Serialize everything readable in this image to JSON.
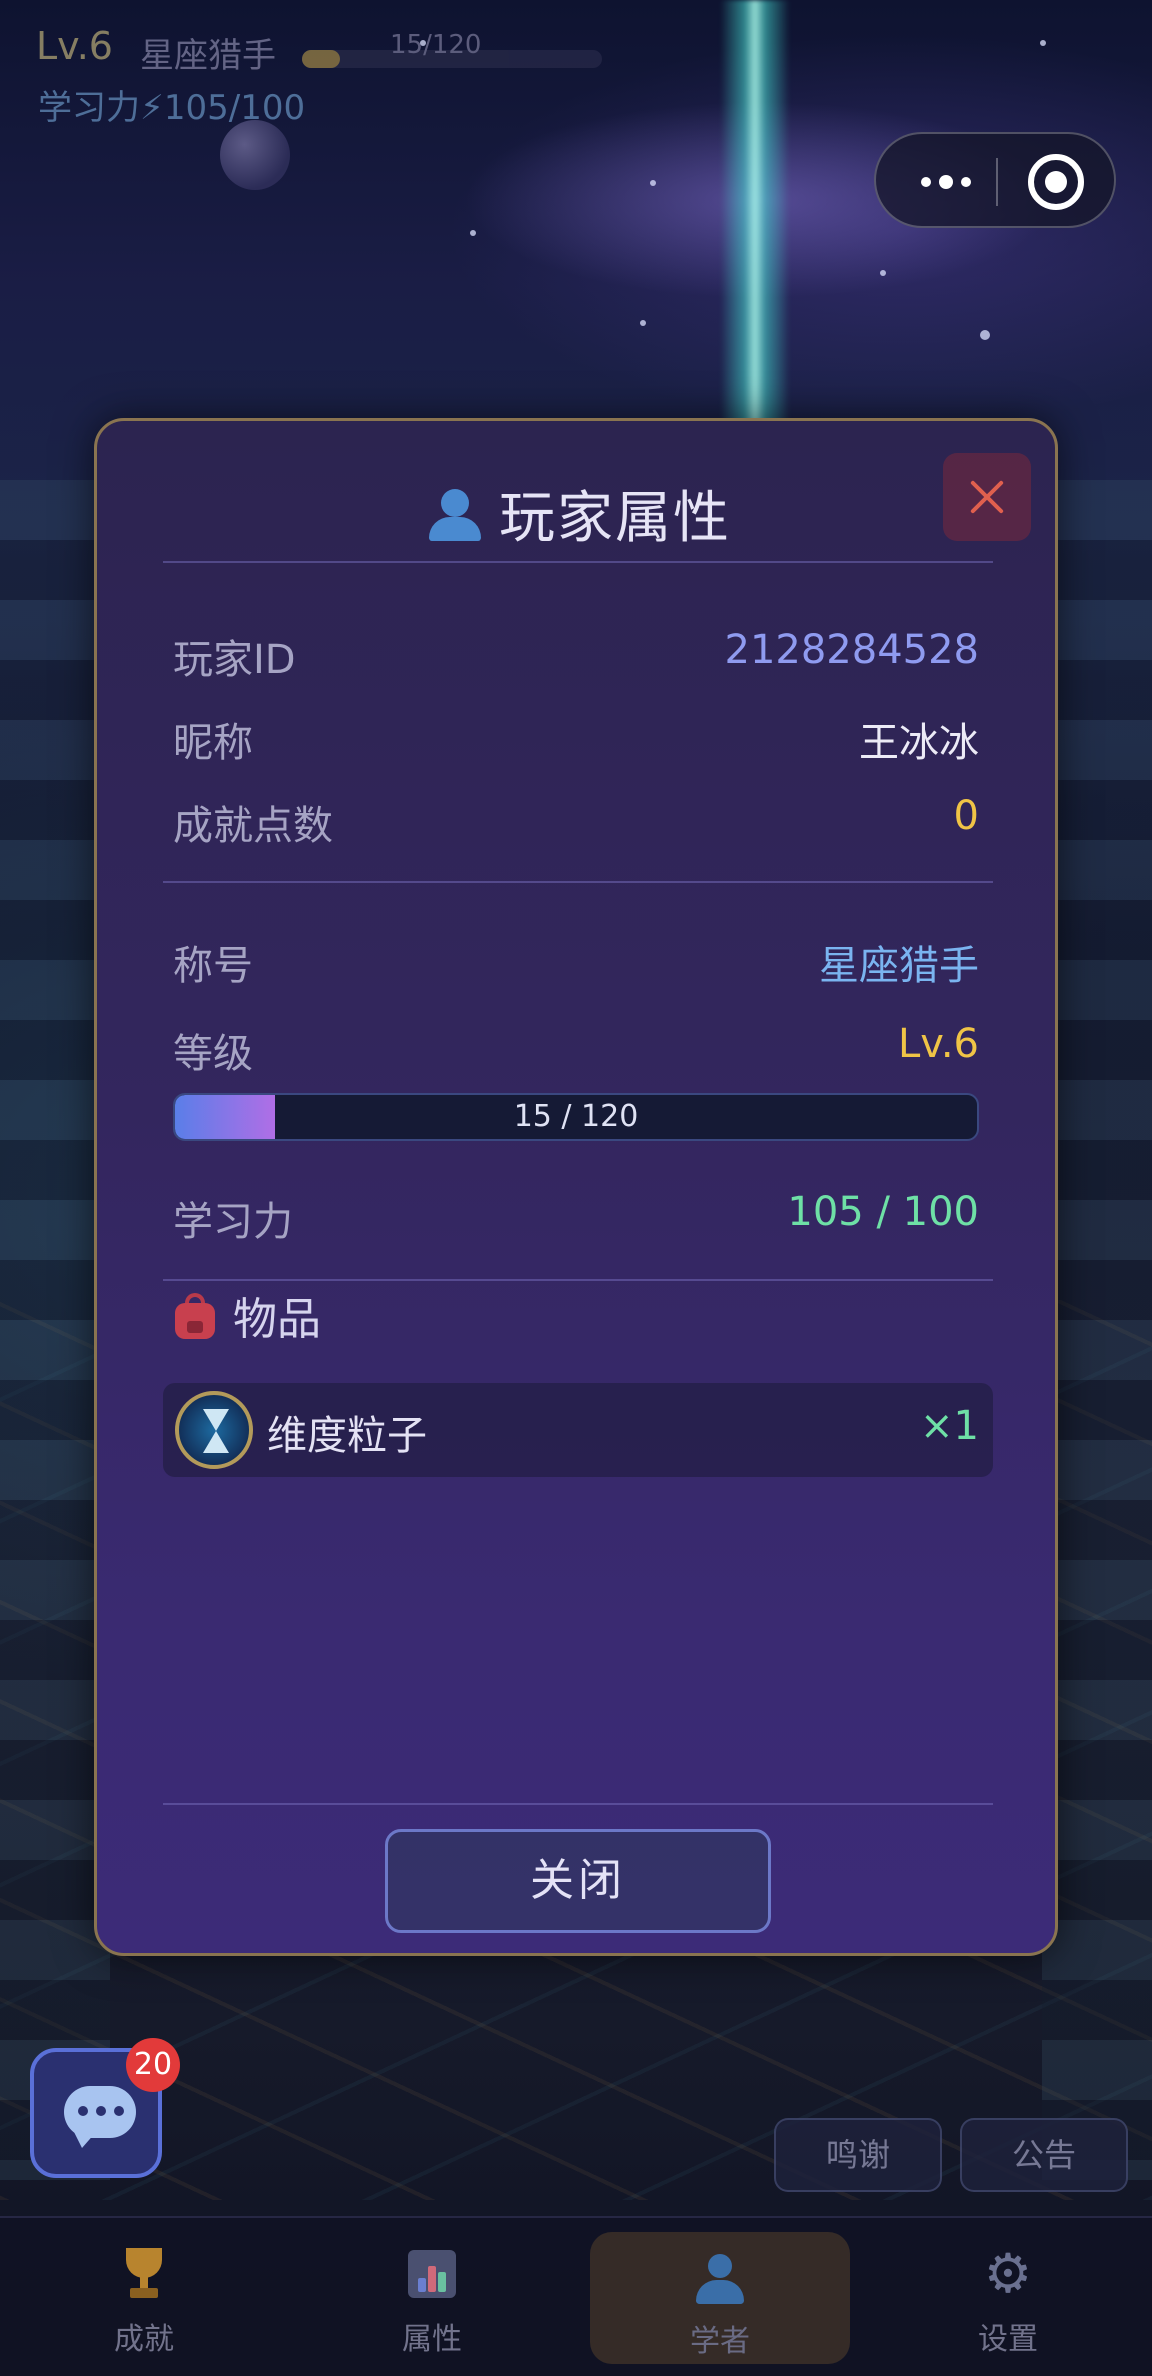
{
  "top_status": {
    "level": "Lv.6",
    "title": "星座猎手",
    "exp_text": "15/120",
    "exp_fraction": 0.125,
    "study_power": "学习力⚡105/100"
  },
  "capsule": {
    "more_icon": "more-dots-icon",
    "target_icon": "target-circle-icon"
  },
  "modal": {
    "title": "玩家属性",
    "title_icon": "player-silhouette-icon",
    "rows_basic": [
      {
        "label": "玩家ID",
        "value": "2128284528",
        "color": "#8f9bf0"
      },
      {
        "label": "昵称",
        "value": "王冰冰",
        "color": "#ecebf6"
      },
      {
        "label": "成就点数",
        "value": "0",
        "color": "#f0c446"
      }
    ],
    "title_row": {
      "label": "称号",
      "value": "星座猎手",
      "color": "#7ab4f0"
    },
    "level_row": {
      "label": "等级",
      "value": "Lv.6",
      "color": "#f0c446"
    },
    "level_progress": {
      "text": "15 / 120",
      "fraction": 0.125
    },
    "study_row": {
      "label": "学习力",
      "value": "105 / 100",
      "color": "#6ee0a6"
    },
    "items_title": "物品",
    "items_icon": "backpack-icon",
    "items": [
      {
        "name": "维度粒子",
        "count": "×1",
        "icon": "hourglass-icon"
      }
    ],
    "close_button": "关闭"
  },
  "chat": {
    "badge": "20",
    "icon": "chat-bubble-icon"
  },
  "side_buttons": [
    "鸣谢",
    "公告"
  ],
  "bottom_nav": [
    {
      "label": "成就",
      "icon": "trophy-icon",
      "active": false
    },
    {
      "label": "属性",
      "icon": "bar-chart-icon",
      "active": false
    },
    {
      "label": "学者",
      "icon": "person-icon",
      "active": true
    },
    {
      "label": "设置",
      "icon": "gear-icon",
      "active": false
    }
  ],
  "colors": {
    "accent_gold": "#f0c446",
    "accent_green": "#6ee0a6",
    "accent_blue": "#8f9bf0",
    "modal_border": "#8a7450",
    "close_red": "#e0604e"
  }
}
